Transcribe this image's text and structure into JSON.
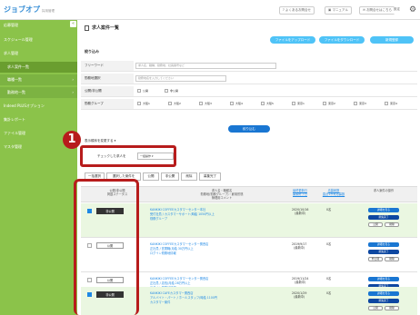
{
  "header": {
    "logo": "ジョブオプ",
    "logo_sub": "採用管理",
    "links": [
      "よくあるお問合せ",
      "マニュアル",
      "お問合せはこちら",
      "設定"
    ]
  },
  "sidebar": {
    "toggle": "«",
    "items": [
      {
        "label": "応募管理",
        "arrow": "›"
      },
      {
        "label": "スケジュール管理",
        "arrow": "›"
      },
      {
        "label": "求人管理",
        "arrow": ""
      },
      {
        "label": "求人案件一覧",
        "arrow": ""
      },
      {
        "label": "職種一覧",
        "arrow": "›"
      },
      {
        "label": "勤務地一覧",
        "arrow": "›"
      },
      {
        "label": "Indeed PLUSオプション",
        "arrow": "›"
      },
      {
        "label": "集計レポート",
        "arrow": "›"
      },
      {
        "label": "ファイル管理",
        "arrow": "›"
      },
      {
        "label": "マスタ管理",
        "arrow": "›"
      }
    ]
  },
  "main": {
    "title": "求人案件一覧",
    "buttons": {
      "upload": "ファイルをアップロード",
      "download": "ファイルをダウンロード",
      "new": "新規登録"
    },
    "filter_title": "絞り込み",
    "filters": {
      "freeword": {
        "label": "フリーワード",
        "placeholder": "求人名、職種、勤務地、社員番号など"
      },
      "location": {
        "label": "勤務地選択",
        "placeholder": "勤務地名を入力してください"
      },
      "status": {
        "label": "公開/非公開",
        "options": [
          "公開",
          "非公開"
        ]
      },
      "group": {
        "label": "勤務グループ",
        "options": [
          "大阪1",
          "大阪2",
          "大阪3",
          "大阪4",
          "大阪5",
          "東京1",
          "東京2",
          "東京3",
          "東京4"
        ]
      }
    },
    "search_button": "絞り込む",
    "sort_label": "表示順序を変更する",
    "bulk_label": "チェックした求人を",
    "bulk_select": "一括操作",
    "tabs": [
      "一括選択",
      "選択した案件を",
      "公開",
      "非公開",
      "削除",
      "募集完了"
    ]
  },
  "table": {
    "headers": [
      {
        "text": "公開/非公開 \n 掲載ステータス",
        "link": false
      },
      {
        "text": "求人名・職種名 \n 勤務地(勤務グループ)・雇用形態 \n 管理用コメント",
        "link": false
      },
      {
        "text": "最終更新日 \n 募集終了日",
        "link": true
      },
      {
        "text": "応募総数 \n 直近1か月応募数",
        "link": true
      },
      {
        "text": "求人案件の操作",
        "link": false
      }
    ],
    "rows": [
      {
        "checked": true,
        "status": "非公開",
        "dark": true,
        "title": "KANKIKI COFFEEカスタマーセンター本社",
        "sub": "受付社員 / カスタマーサポート(時給 1050円以上",
        "note": "勤務グループ",
        "date": "2020/10/16 \n (最新中)",
        "count": "0名",
        "actions": [
          "詳細を見る",
          "募集完了",
          "公開",
          "削除"
        ]
      },
      {
        "checked": false,
        "status": "公開",
        "dark": false,
        "title": "KANKIKI COFFEEカスタマーセンター関西店",
        "sub": "正社員 / 営業職(月給 30万円以上",
        "note": "ログイン勤務地情報",
        "date": "2019/9/17 \n (最新中)",
        "count": "0名",
        "actions": [
          "詳細を見る",
          "募集完了",
          "非公開",
          "削除"
        ]
      },
      {
        "checked": false,
        "status": "公開",
        "dark": false,
        "title": "KANKIKI COFFEEカスタマーセンター関西店",
        "sub": "正社員 / 店長(月給 28万円以上",
        "note": "ログイン勤務地情報",
        "date": "2019/11/24 \n (最新中)",
        "count": "0名",
        "actions": [
          "詳細を見る",
          "募集完了",
          "非公開",
          "削除"
        ]
      },
      {
        "checked": true,
        "status": "非公開",
        "dark": true,
        "title": "KANKIKI CAFEカスタマー関西店",
        "sub": "アルバイト・パート / ホールスタッフ(時給 1100円",
        "note": "カスタマー案件",
        "date": "2020/1/29 \n (最新中)",
        "count": "0名",
        "actions": [
          "詳細を見る",
          "募集完了",
          "公開",
          "削除"
        ]
      }
    ]
  },
  "annotation": {
    "number": "1",
    "color": "#b71c1c"
  }
}
